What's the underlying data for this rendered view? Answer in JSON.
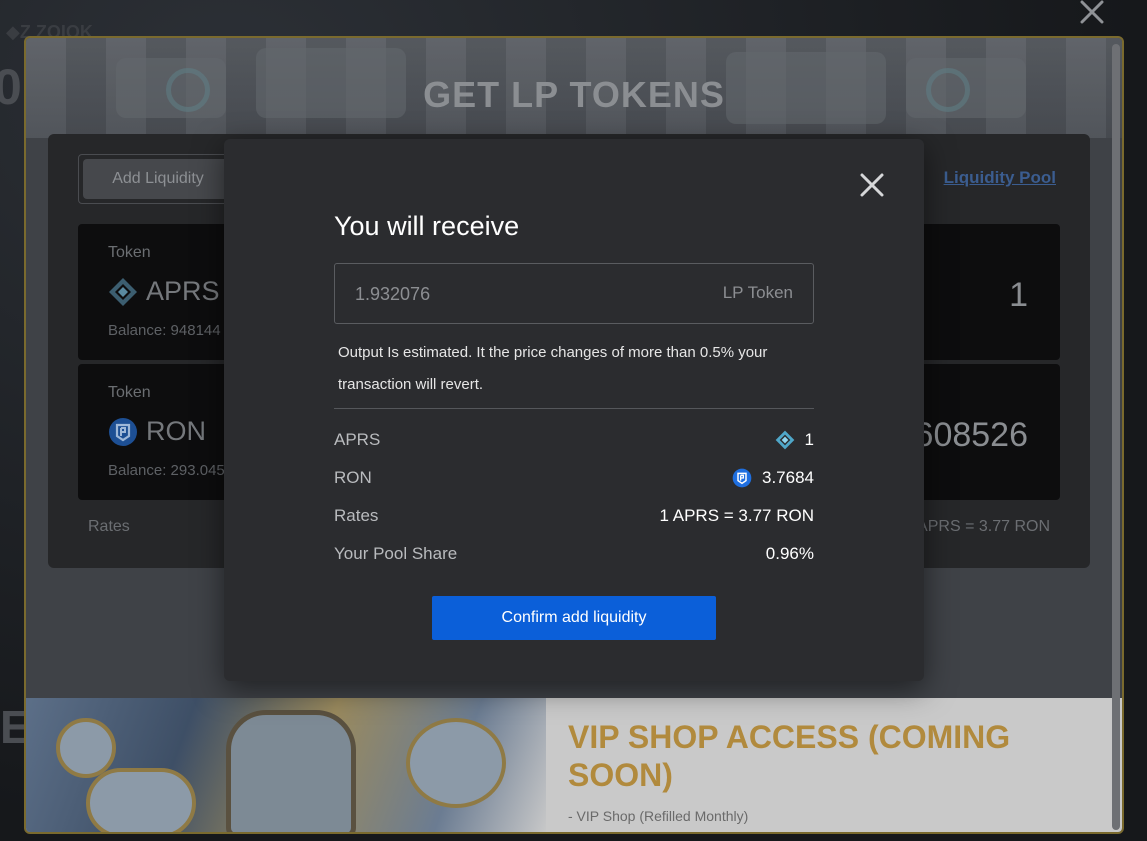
{
  "background": {
    "fragment_top": "◆Z ZOIOK",
    "fragment_letter_o": "0",
    "fragment_letter_e": "E"
  },
  "outer": {
    "title": "GET LP TOKENS",
    "tab_add_liquidity": "Add Liquidity",
    "liquidity_pool_link": "Liquidity Pool",
    "token_label": "Token",
    "tokens": [
      {
        "symbol": "APRS",
        "balance": "Balance: 948144",
        "amount": "1",
        "icon": "aprs-diamond-icon"
      },
      {
        "symbol": "RON",
        "balance": "Balance: 293.045",
        "amount": "3.77608526",
        "icon": "ron-shield-icon"
      }
    ],
    "rates_label": "Rates",
    "rates_value": "1 APRS = 3.77 RON"
  },
  "promo": {
    "title": "VIP SHOP ACCESS (COMING SOON)",
    "item": "- VIP Shop (Refilled Monthly)"
  },
  "dialog": {
    "title": "You will receive",
    "output_value": "1.932076",
    "output_unit": "LP Token",
    "note": "Output Is estimated. It the price changes of more than 0.5% your transaction will revert.",
    "rows": [
      {
        "label": "APRS",
        "value": "1",
        "icon": "aprs-diamond-icon"
      },
      {
        "label": "RON",
        "value": "3.7684",
        "icon": "ron-shield-icon"
      },
      {
        "label": "Rates",
        "value": "1 APRS = 3.77 RON"
      },
      {
        "label": "Your Pool Share",
        "value": "0.96%"
      }
    ],
    "confirm_label": "Confirm add liquidity"
  },
  "colors": {
    "accent_blue": "#0b5fd9",
    "dialog_bg": "#2b2c2f",
    "promo_gold": "#b18a3d",
    "frame_gold": "#7a6a2e"
  }
}
